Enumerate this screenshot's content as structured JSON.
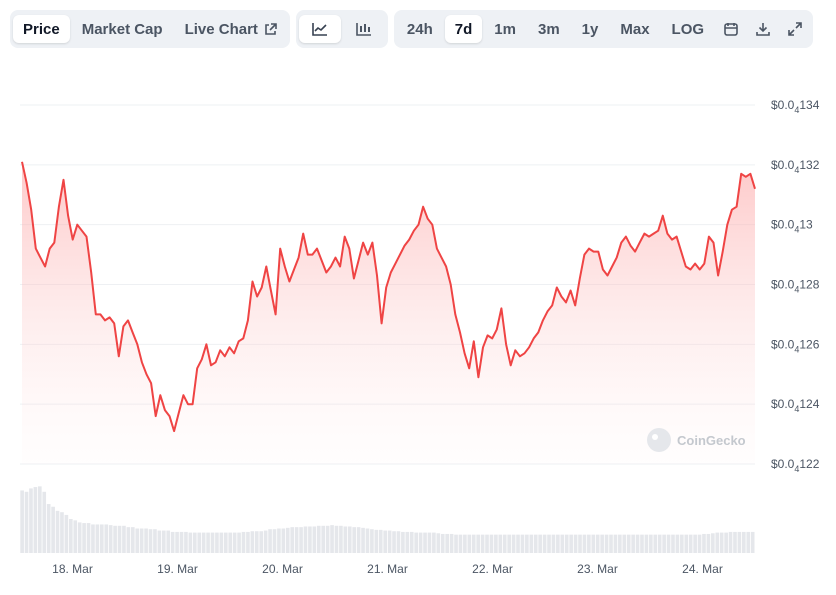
{
  "toolbar": {
    "tabs": [
      {
        "label": "Price",
        "active": true
      },
      {
        "label": "Market Cap",
        "active": false
      },
      {
        "label": "Live Chart",
        "active": false,
        "icon": "external-link-icon"
      }
    ],
    "chart_type_buttons": [
      {
        "icon": "line-chart-icon",
        "active": true
      },
      {
        "icon": "candlestick-chart-icon",
        "active": false
      }
    ],
    "ranges": [
      {
        "label": "24h",
        "active": false
      },
      {
        "label": "7d",
        "active": true
      },
      {
        "label": "1m",
        "active": false
      },
      {
        "label": "3m",
        "active": false
      },
      {
        "label": "1y",
        "active": false
      },
      {
        "label": "Max",
        "active": false
      },
      {
        "label": "LOG",
        "active": false
      }
    ],
    "tools": [
      {
        "icon": "calendar-icon"
      },
      {
        "icon": "download-icon"
      },
      {
        "icon": "expand-icon"
      }
    ]
  },
  "watermark": "CoinGecko",
  "colors": {
    "line": "#ef4444",
    "fill": "#fecaca",
    "volume": "#e5e7eb",
    "grid": "#eef0f3",
    "text": "#4b5563"
  },
  "chart_data": {
    "type": "line",
    "title": "",
    "xlabel": "",
    "ylabel": "",
    "y_ticks": [
      {
        "prefix": "$0.0",
        "sub": "4",
        "digits": "134",
        "value": 1.34
      },
      {
        "prefix": "$0.0",
        "sub": "4",
        "digits": "132",
        "value": 1.32
      },
      {
        "prefix": "$0.0",
        "sub": "4",
        "digits": "13",
        "value": 1.3
      },
      {
        "prefix": "$0.0",
        "sub": "4",
        "digits": "128",
        "value": 1.28
      },
      {
        "prefix": "$0.0",
        "sub": "4",
        "digits": "126",
        "value": 1.26
      },
      {
        "prefix": "$0.0",
        "sub": "4",
        "digits": "124",
        "value": 1.24
      },
      {
        "prefix": "$0.0",
        "sub": "4",
        "digits": "122",
        "value": 1.22
      }
    ],
    "y_unit_note": "values in units of 1e-5 USD",
    "ylim": [
      1.22,
      1.34
    ],
    "x_ticks": [
      {
        "label": "18. Mar",
        "x": 0.5
      },
      {
        "label": "19. Mar",
        "x": 1.5
      },
      {
        "label": "20. Mar",
        "x": 2.5
      },
      {
        "label": "21. Mar",
        "x": 3.5
      },
      {
        "label": "22. Mar",
        "x": 4.5
      },
      {
        "label": "23. Mar",
        "x": 5.5
      },
      {
        "label": "24. Mar",
        "x": 6.5
      }
    ],
    "xlim": [
      0,
      7.0
    ],
    "series": [
      {
        "values": [
          1.321,
          1.314,
          1.305,
          1.292,
          1.289,
          1.286,
          1.292,
          1.294,
          1.306,
          1.315,
          1.303,
          1.295,
          1.3,
          1.298,
          1.296,
          1.284,
          1.27,
          1.27,
          1.268,
          1.269,
          1.267,
          1.256,
          1.266,
          1.268,
          1.264,
          1.26,
          1.254,
          1.25,
          1.247,
          1.236,
          1.243,
          1.238,
          1.236,
          1.231,
          1.237,
          1.243,
          1.24,
          1.24,
          1.252,
          1.255,
          1.26,
          1.253,
          1.254,
          1.258,
          1.256,
          1.259,
          1.257,
          1.261,
          1.262,
          1.268,
          1.281,
          1.276,
          1.279,
          1.286,
          1.278,
          1.27,
          1.292,
          1.286,
          1.281,
          1.285,
          1.289,
          1.297,
          1.29,
          1.29,
          1.292,
          1.288,
          1.284,
          1.286,
          1.289,
          1.286,
          1.296,
          1.292,
          1.282,
          1.288,
          1.294,
          1.29,
          1.294,
          1.283,
          1.267,
          1.279,
          1.284,
          1.287,
          1.29,
          1.293,
          1.295,
          1.298,
          1.3,
          1.306,
          1.302,
          1.3,
          1.292,
          1.289,
          1.286,
          1.28,
          1.27,
          1.264,
          1.257,
          1.252,
          1.261,
          1.249,
          1.259,
          1.263,
          1.262,
          1.265,
          1.272,
          1.26,
          1.253,
          1.258,
          1.256,
          1.257,
          1.259,
          1.262,
          1.264,
          1.268,
          1.271,
          1.273,
          1.279,
          1.276,
          1.274,
          1.278,
          1.273,
          1.282,
          1.29,
          1.292,
          1.291,
          1.291,
          1.285,
          1.283,
          1.286,
          1.289,
          1.294,
          1.296,
          1.293,
          1.291,
          1.294,
          1.297,
          1.296,
          1.297,
          1.298,
          1.303,
          1.297,
          1.295,
          1.296,
          1.291,
          1.286,
          1.285,
          1.287,
          1.285,
          1.287,
          1.296,
          1.294,
          1.283,
          1.291,
          1.3,
          1.305,
          1.306,
          1.317,
          1.316,
          1.317,
          1.312
        ]
      }
    ],
    "volume_relative": [
      0.92,
      0.9,
      0.95,
      0.97,
      0.98,
      0.9,
      0.72,
      0.68,
      0.62,
      0.6,
      0.56,
      0.5,
      0.48,
      0.45,
      0.44,
      0.44,
      0.42,
      0.42,
      0.42,
      0.42,
      0.41,
      0.4,
      0.4,
      0.4,
      0.38,
      0.38,
      0.36,
      0.36,
      0.36,
      0.35,
      0.35,
      0.33,
      0.33,
      0.33,
      0.31,
      0.31,
      0.31,
      0.31,
      0.3,
      0.3,
      0.3,
      0.3,
      0.3,
      0.3,
      0.3,
      0.3,
      0.3,
      0.3,
      0.3,
      0.3,
      0.31,
      0.31,
      0.32,
      0.32,
      0.32,
      0.33,
      0.35,
      0.35,
      0.36,
      0.36,
      0.37,
      0.38,
      0.38,
      0.38,
      0.39,
      0.39,
      0.39,
      0.4,
      0.4,
      0.4,
      0.41,
      0.4,
      0.4,
      0.39,
      0.39,
      0.38,
      0.38,
      0.37,
      0.36,
      0.35,
      0.34,
      0.34,
      0.33,
      0.33,
      0.32,
      0.32,
      0.31,
      0.31,
      0.31,
      0.3,
      0.3,
      0.3,
      0.3,
      0.3,
      0.29,
      0.28,
      0.28,
      0.28,
      0.27,
      0.27,
      0.27,
      0.27,
      0.27,
      0.27,
      0.27,
      0.27,
      0.27,
      0.27,
      0.27,
      0.27,
      0.27,
      0.27,
      0.27,
      0.27,
      0.27,
      0.27,
      0.27,
      0.27,
      0.27,
      0.27,
      0.27,
      0.27,
      0.27,
      0.27,
      0.27,
      0.27,
      0.27,
      0.27,
      0.27,
      0.27,
      0.27,
      0.27,
      0.27,
      0.27,
      0.27,
      0.27,
      0.27,
      0.27,
      0.27,
      0.27,
      0.27,
      0.27,
      0.27,
      0.27,
      0.27,
      0.27,
      0.27,
      0.27,
      0.27,
      0.27,
      0.27,
      0.27,
      0.27,
      0.27,
      0.28,
      0.28,
      0.29,
      0.3,
      0.3,
      0.3,
      0.31,
      0.31,
      0.31,
      0.31,
      0.31,
      0.31
    ]
  }
}
